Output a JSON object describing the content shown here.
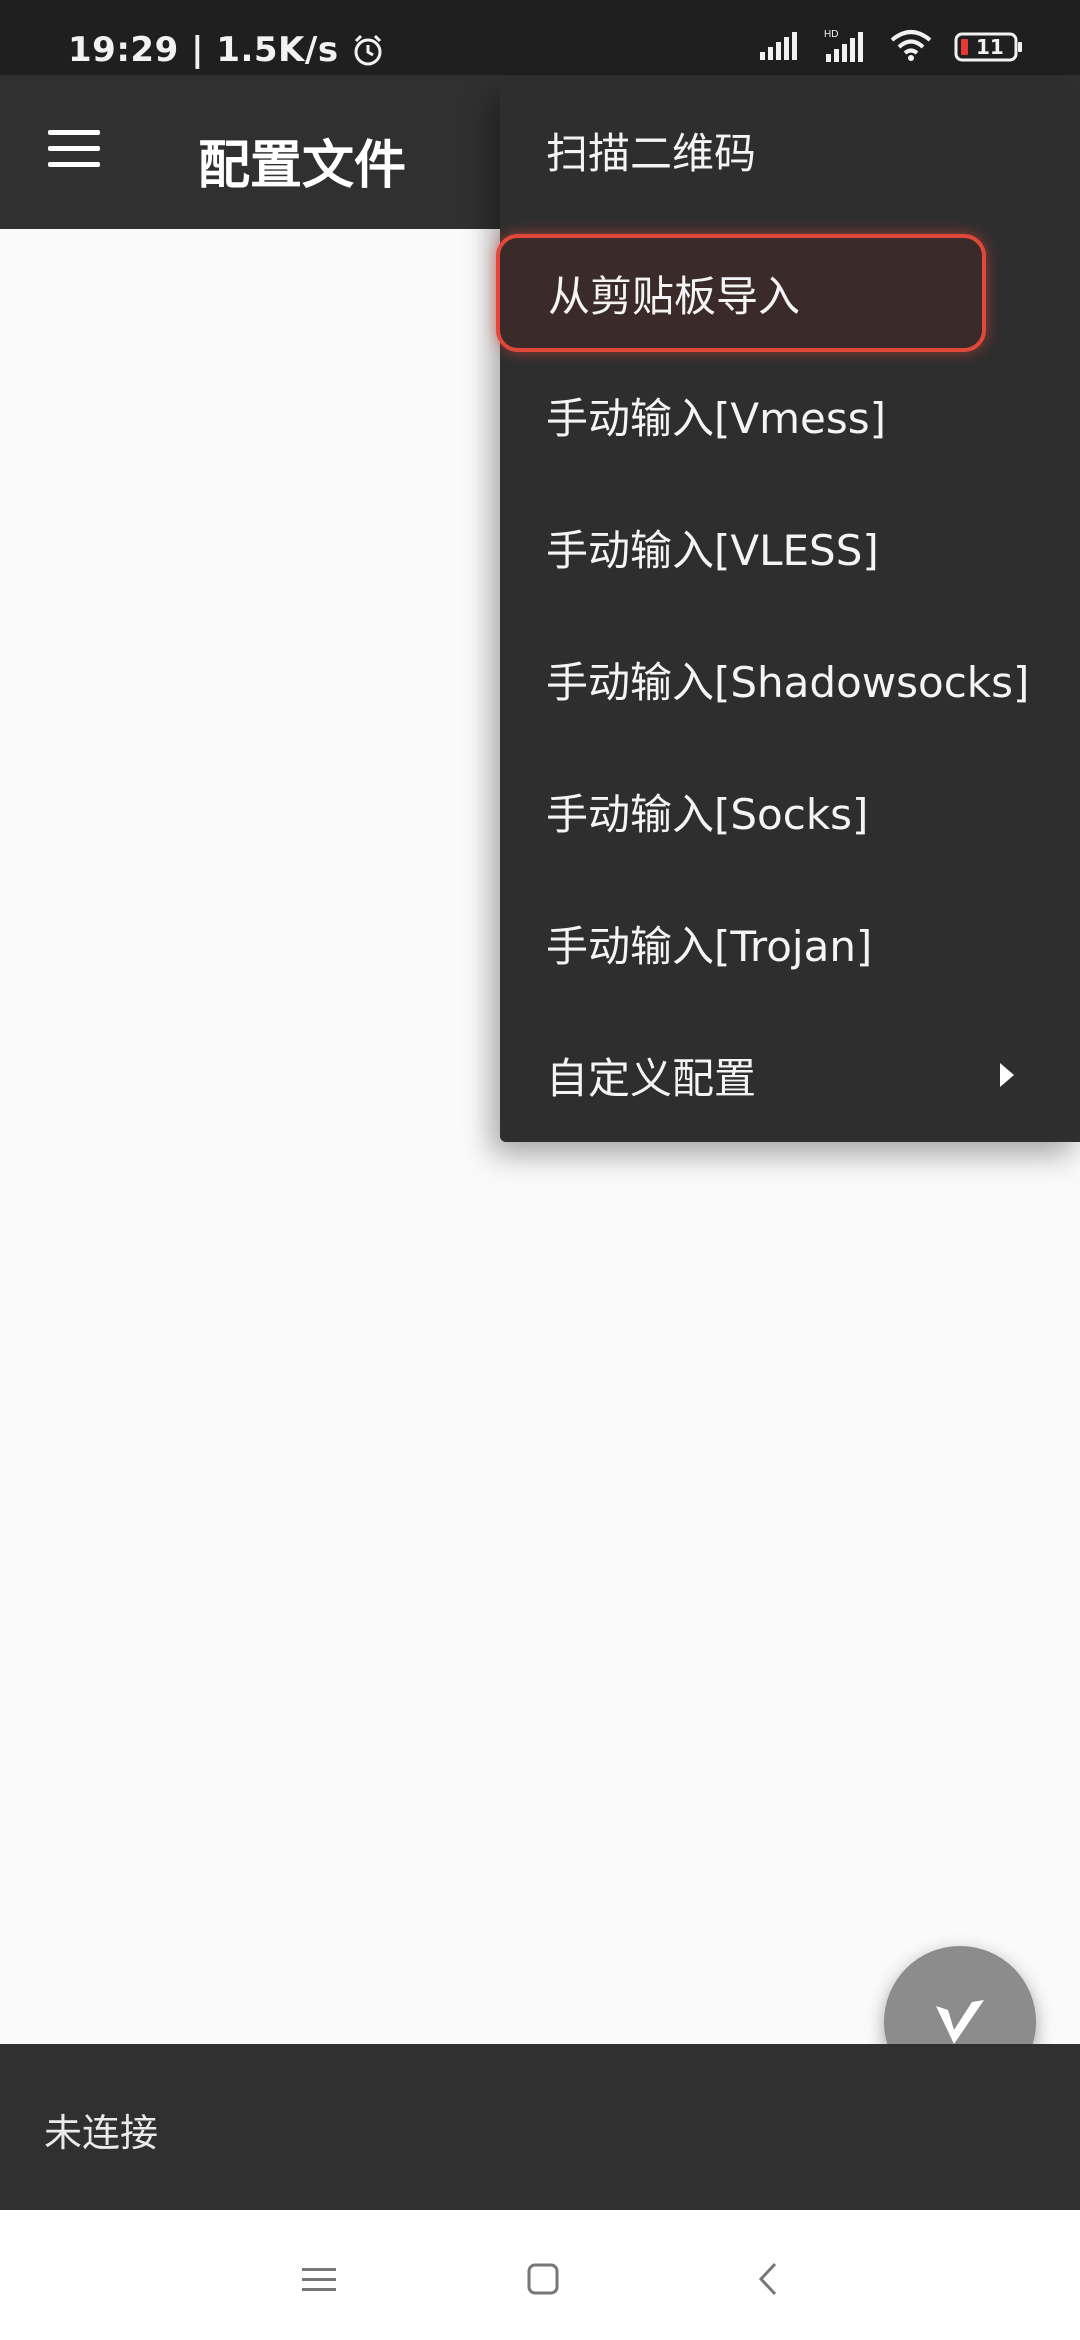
{
  "status_bar": {
    "time_speed": "19:29 | 1.5K/s",
    "battery": "11",
    "icons": [
      "alarm-icon",
      "signal-icon",
      "hd-signal-icon",
      "wifi-icon",
      "battery-icon"
    ]
  },
  "app_bar": {
    "title": "配置文件",
    "menu_icon": "hamburger-menu-icon"
  },
  "dropdown_menu": {
    "items": [
      {
        "label": "扫描二维码"
      },
      {
        "label": "从剪贴板导入",
        "highlighted": true
      },
      {
        "label": "手动输入[Vmess]"
      },
      {
        "label": "手动输入[VLESS]"
      },
      {
        "label": "手动输入[Shadowsocks]"
      },
      {
        "label": "手动输入[Socks]"
      },
      {
        "label": "手动输入[Trojan]"
      },
      {
        "label": "自定义配置",
        "has_submenu": true
      }
    ]
  },
  "fab": {
    "icon": "v-logo-icon"
  },
  "bottom_status": {
    "text": "未连接"
  },
  "nav_bar": {
    "icons": [
      "recents-icon",
      "home-icon",
      "back-icon"
    ]
  },
  "colors": {
    "app_bar": "#303030",
    "menu_bg": "#2e2e2e",
    "highlight_border": "#e0483a",
    "fab": "#8c8c8c",
    "content_bg": "#fafafa"
  }
}
